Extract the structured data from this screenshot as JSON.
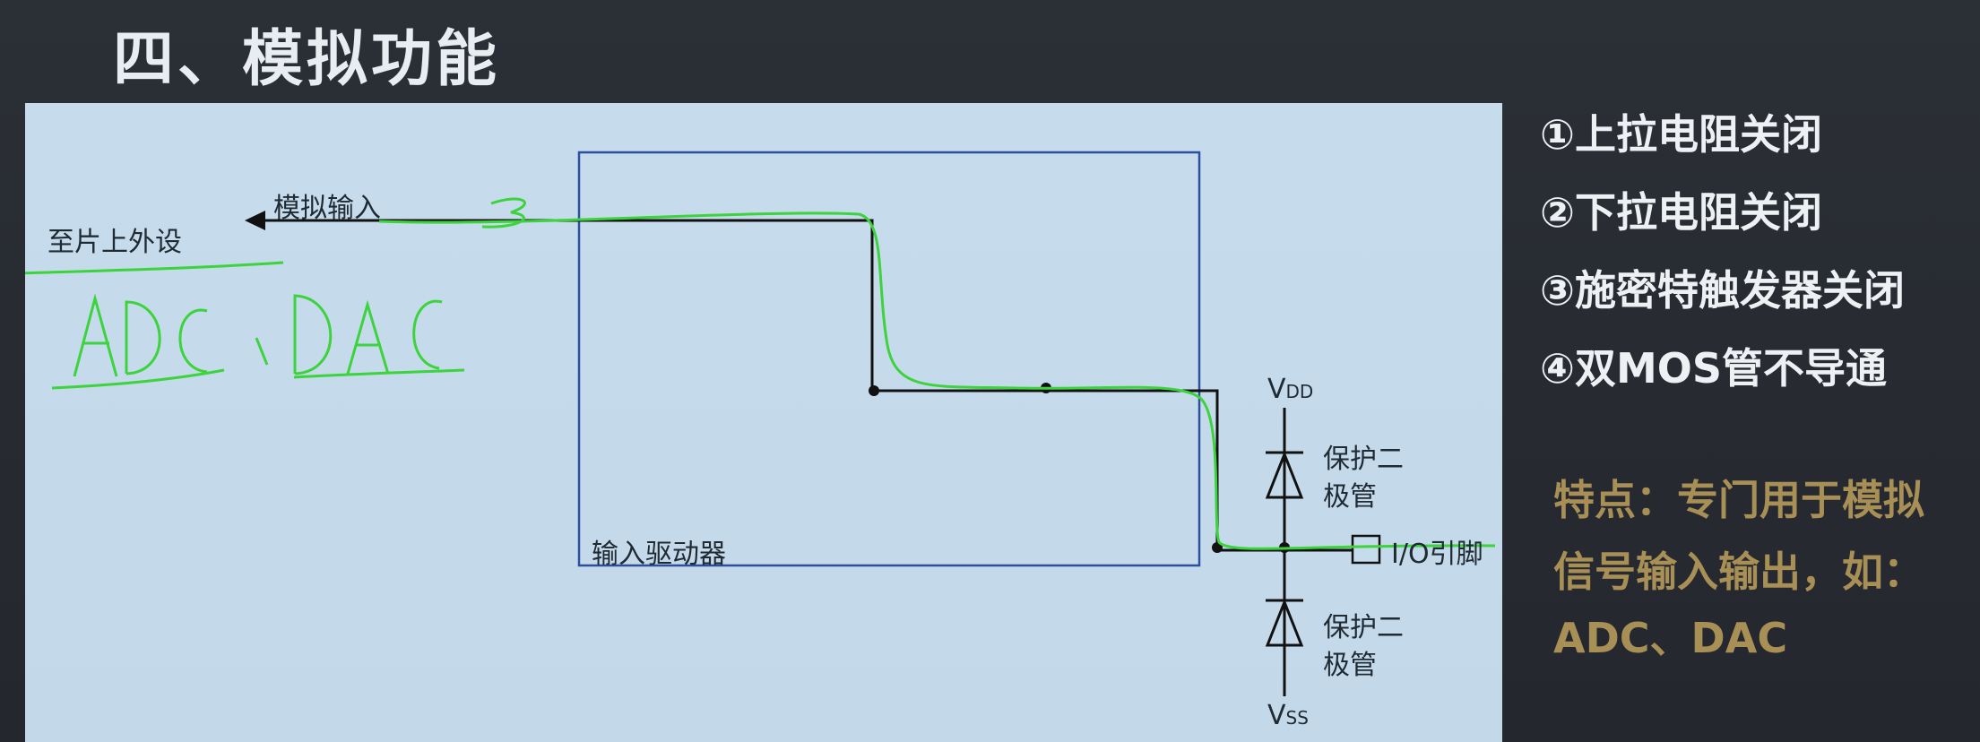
{
  "slide": {
    "title": "四、模拟功能"
  },
  "diagram": {
    "to_peripheral": "至片上外设",
    "analog_input": "模拟输入",
    "input_driver": "输入驱动器",
    "vdd": {
      "base": "V",
      "sub": "DD"
    },
    "vss": {
      "base": "V",
      "sub": "SS"
    },
    "protect_diode_top": "保护二极管",
    "protect_diode_bottom": "保护二极管",
    "io_pin": "I/O引脚",
    "handwritten_note": "ADC、DAC"
  },
  "features": [
    "①上拉电阻关闭",
    "②下拉电阻关闭",
    "③施密特触发器关闭",
    "④双MOS管不导通"
  ],
  "note": {
    "line1": "特点：专门用于模拟",
    "line2": "信号输入输出，如：",
    "line3": "ADC、DAC"
  },
  "colors": {
    "annotation_green": "#3dd33d",
    "note_gold": "#a78f55"
  }
}
